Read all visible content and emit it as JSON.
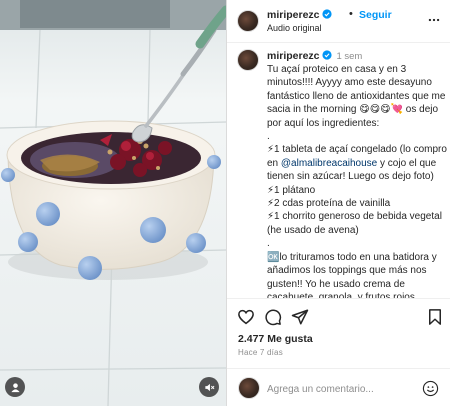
{
  "post": {
    "username": "miriperezc",
    "follow_label": "Seguir",
    "audio_label": "Audio original",
    "separator": "•"
  },
  "caption": {
    "username": "miriperezc",
    "time": "1 sem",
    "text_1": "Tu açaí proteico en casa y en 3 minutos!!!! Ayyyy amo este desayuno fantástico lleno de antioxidantes que me sacia in the morning ",
    "emoji_1": "😋😋😋💘",
    "text_2": " os dejo por aquí los ingredientes:\n.\n",
    "bolt_1": "⚡",
    "line_1a": "1 tableta de açaí congelado (lo compro en ",
    "mention": "@almalibreacaihouse",
    "line_1b": " y cojo el que tienen sin azúcar! Luego os dejo foto)\n",
    "bolt_2": "⚡",
    "line_2": "1 plátano\n",
    "bolt_3": "⚡",
    "line_3": "2 cdas proteína de vainilla\n",
    "bolt_4": "⚡",
    "line_4": "1 chorrito generoso de bebida vegetal (he usado de avena)\n.\n",
    "box_emoji": "🆗",
    "line_5": "lo trituramos todo en una batidora y añadimos los toppings que más nos gusten!! Yo he usado crema de cacahuete, granola, y frutos rojos.\nVoilà!!!!! ",
    "emoji_end": "😋💘"
  },
  "engagement": {
    "likes": "2.477 Me gusta",
    "time_ago": "Hace 7 días"
  },
  "comment": {
    "placeholder": "Agrega un comentario..."
  },
  "colors": {
    "link": "#0095f6",
    "mention": "#00376b",
    "muted": "#8e8e8e",
    "text": "#262626",
    "bowl_dot": "#8fb1dd"
  },
  "icons": {
    "verified": "verified-badge-icon",
    "more": "more-options-icon",
    "like": "heart-icon",
    "comment": "comment-bubble-icon",
    "share": "paper-plane-icon",
    "save": "bookmark-icon",
    "emoji": "smiley-face-icon",
    "user": "user-tags-icon",
    "mute": "speaker-muted-icon"
  }
}
